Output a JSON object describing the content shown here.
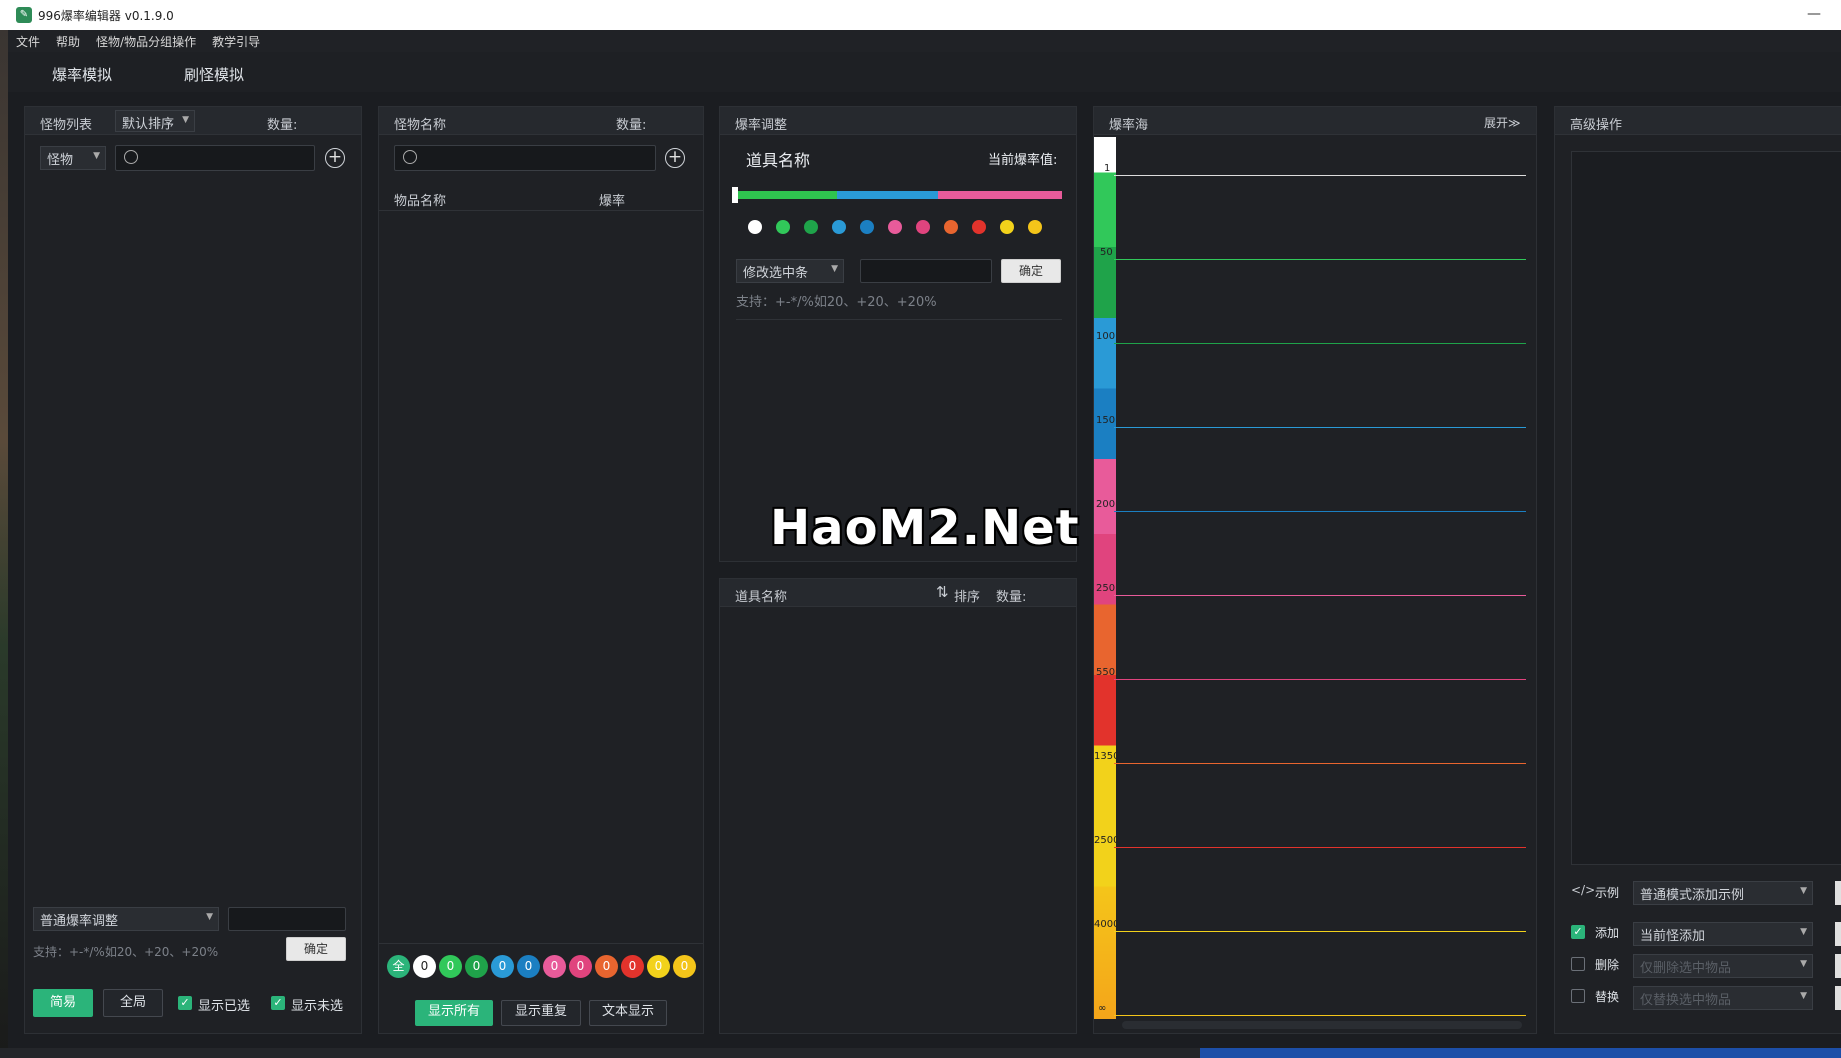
{
  "window": {
    "title": "996爆率编辑器 v0.1.9.0",
    "minimize": "—"
  },
  "menu": [
    "文件",
    "帮助",
    "怪物/物品分组操作",
    "教学引导"
  ],
  "tabs": [
    "爆率模拟",
    "刷怪模拟"
  ],
  "monster_panel": {
    "header": "怪物列表",
    "sort": "默认排序",
    "count_label": "数量:",
    "filter": "怪物",
    "search_placeholder": "",
    "mode_select": "普通爆率调整",
    "mode_value": "",
    "hint": "支持：+-*/%如20、+20、+20%",
    "confirm": "确定",
    "btn_simple": "简易",
    "btn_global": "全局",
    "show_selected": "显示已选",
    "show_unselected": "显示未选"
  },
  "items_panel": {
    "header": "怪物名称",
    "count_label": "数量:",
    "col_name": "物品名称",
    "col_rate": "爆率",
    "all_label": "全",
    "counts": [
      "0",
      "0",
      "0",
      "0",
      "0",
      "0",
      "0",
      "0",
      "0",
      "0",
      "0"
    ],
    "btn_show_all": "显示所有",
    "btn_show_dup": "显示重复",
    "btn_text": "文本显示"
  },
  "adjust_panel": {
    "header": "爆率调整",
    "item_name": "道具名称",
    "current_rate": "当前爆率值:",
    "modify_select": "修改选中条",
    "modify_value": "",
    "confirm": "确定",
    "hint": "支持：+-*/%如20、+20、+20%",
    "watermark": "HaoM2.Net"
  },
  "items_list_panel": {
    "header": "道具名称",
    "sort_label": "排序",
    "count_label": "数量:"
  },
  "sea_panel": {
    "header": "爆率海",
    "expand": "展开≫",
    "levels": [
      "1",
      "50",
      "100",
      "150",
      "200",
      "250",
      "550",
      "1350",
      "2500",
      "4000",
      "∞"
    ]
  },
  "advanced_panel": {
    "header": "高级操作",
    "example_label": "示例",
    "example_select": "普通模式添加示例",
    "add_label": "添加",
    "add_select": "当前怪添加",
    "delete_label": "删除",
    "delete_select": "仅删除选中物品",
    "replace_label": "替换",
    "replace_select": "仅替换选中物品"
  },
  "colors": {
    "accent": "#2bb47a",
    "white": "#ffffff",
    "green1": "#31c85a",
    "green2": "#1fa34a",
    "blue1": "#2a9ad6",
    "blue2": "#1b7fc2",
    "pink1": "#e85b9a",
    "pink2": "#e0447e",
    "orange": "#e8652f",
    "red": "#e2332c",
    "yellow1": "#f2d21b",
    "yellow2": "#f4c51a"
  }
}
